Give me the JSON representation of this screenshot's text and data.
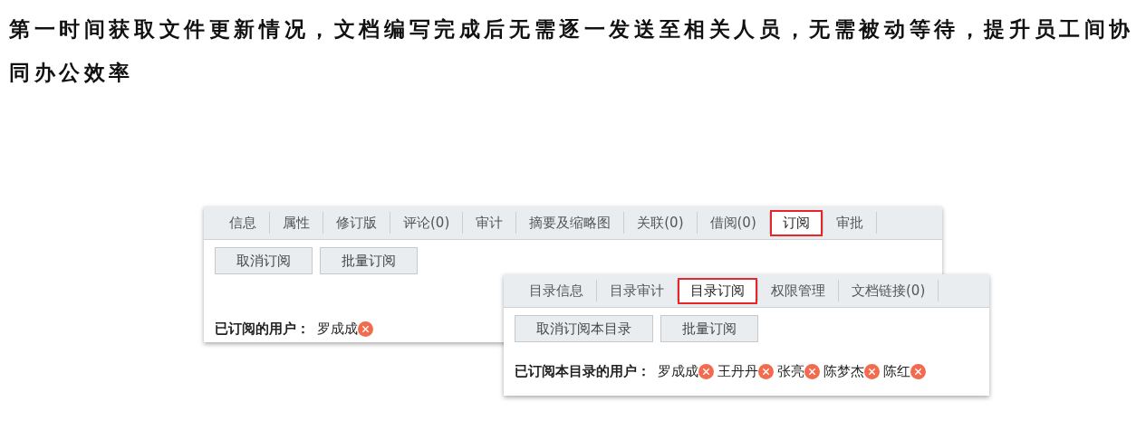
{
  "heading": "第一时间获取文件更新情况，文档编写完成后无需逐一发送至相关人员，无需被动等待，提升员工间协同办公效率",
  "panels": [
    {
      "tabs": [
        {
          "label": "信息",
          "selected": false
        },
        {
          "label": "属性",
          "selected": false
        },
        {
          "label": "修订版",
          "selected": false
        },
        {
          "label": "评论(0)",
          "selected": false
        },
        {
          "label": "审计",
          "selected": false
        },
        {
          "label": "摘要及缩略图",
          "selected": false
        },
        {
          "label": "关联(0)",
          "selected": false
        },
        {
          "label": "借阅(0)",
          "selected": false
        },
        {
          "label": "订阅",
          "selected": true
        },
        {
          "label": "审批",
          "selected": false
        }
      ],
      "buttons": [
        "取消订阅",
        "批量订阅"
      ],
      "users_label": "已订阅的用户：",
      "users": [
        "罗成成"
      ]
    },
    {
      "tabs": [
        {
          "label": "目录信息",
          "selected": false
        },
        {
          "label": "目录审计",
          "selected": false
        },
        {
          "label": "目录订阅",
          "selected": true
        },
        {
          "label": "权限管理",
          "selected": false
        },
        {
          "label": "文档链接(0)",
          "selected": false
        }
      ],
      "buttons": [
        "取消订阅本目录",
        "批量订阅"
      ],
      "users_label": "已订阅本目录的用户：",
      "users": [
        "罗成成",
        "王丹丹",
        "张亮",
        "陈梦杰",
        "陈红"
      ]
    }
  ]
}
